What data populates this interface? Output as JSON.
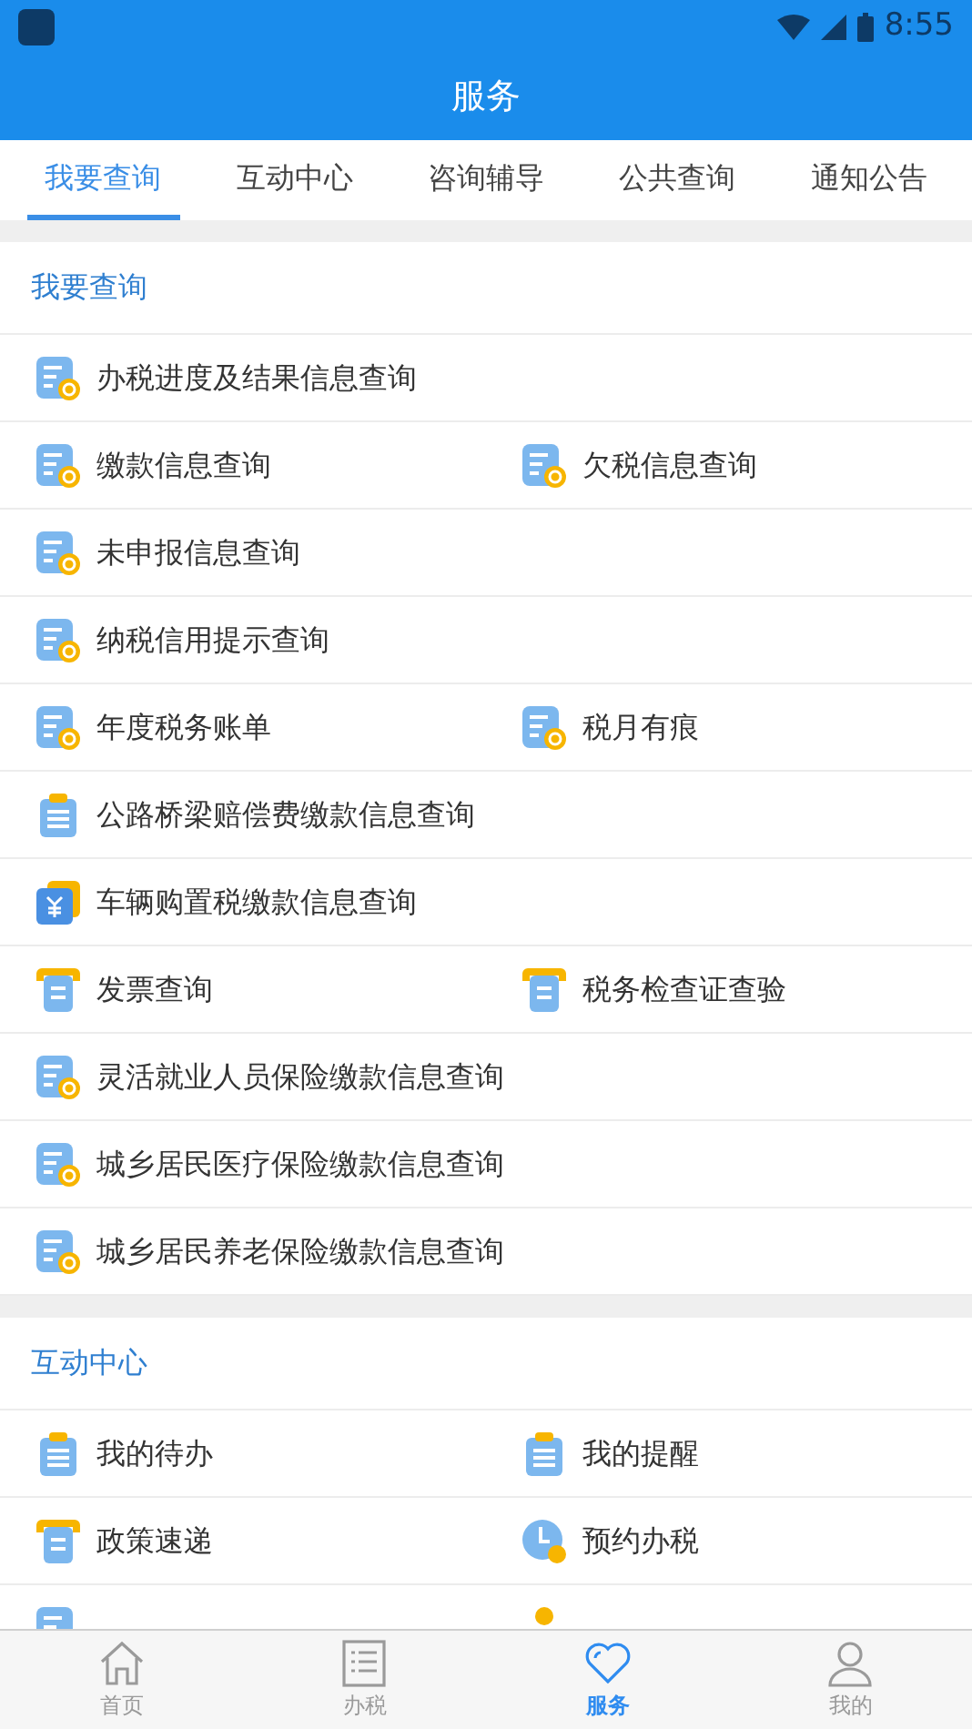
{
  "status_bar": {
    "time": "8:55"
  },
  "header": {
    "title": "服务"
  },
  "tabs": [
    {
      "label": "我要查询",
      "selected": true
    },
    {
      "label": "互动中心",
      "selected": false
    },
    {
      "label": "咨询辅导",
      "selected": false
    },
    {
      "label": "公共查询",
      "selected": false
    },
    {
      "label": "通知公告",
      "selected": false
    }
  ],
  "sections": [
    {
      "title": "我要查询",
      "rows": [
        [
          {
            "label": "办税进度及结果信息查询",
            "kind": "doc-search"
          }
        ],
        [
          {
            "label": "缴款信息查询",
            "kind": "doc-search"
          },
          {
            "label": "欠税信息查询",
            "kind": "doc-search"
          }
        ],
        [
          {
            "label": "未申报信息查询",
            "kind": "doc-search"
          }
        ],
        [
          {
            "label": "纳税信用提示查询",
            "kind": "doc-search"
          }
        ],
        [
          {
            "label": "年度税务账单",
            "kind": "doc-search"
          },
          {
            "label": "税月有痕",
            "kind": "doc-search"
          }
        ],
        [
          {
            "label": "公路桥梁赔偿费缴款信息查询",
            "kind": "clipboard"
          }
        ],
        [
          {
            "label": "车辆购置税缴款信息查询",
            "kind": "yuan"
          }
        ],
        [
          {
            "label": "发票查询",
            "kind": "tray"
          },
          {
            "label": "税务检查证查验",
            "kind": "tray"
          }
        ],
        [
          {
            "label": "灵活就业人员保险缴款信息查询",
            "kind": "doc-search"
          }
        ],
        [
          {
            "label": "城乡居民医疗保险缴款信息查询",
            "kind": "doc-search"
          }
        ],
        [
          {
            "label": "城乡居民养老保险缴款信息查询",
            "kind": "doc-search"
          }
        ]
      ]
    },
    {
      "title": "互动中心",
      "rows": [
        [
          {
            "label": "我的待办",
            "kind": "clipboard"
          },
          {
            "label": "我的提醒",
            "kind": "clipboard"
          }
        ],
        [
          {
            "label": "政策速递",
            "kind": "tray"
          },
          {
            "label": "预约办税",
            "kind": "clock"
          }
        ],
        [
          {
            "kind": "doc-edit"
          },
          {
            "kind": "person"
          }
        ]
      ]
    }
  ],
  "bottom_nav": [
    {
      "label": "首页",
      "kind": "home",
      "selected": false
    },
    {
      "label": "办税",
      "kind": "list",
      "selected": false
    },
    {
      "label": "服务",
      "kind": "heart",
      "selected": true
    },
    {
      "label": "我的",
      "kind": "user",
      "selected": false
    }
  ]
}
